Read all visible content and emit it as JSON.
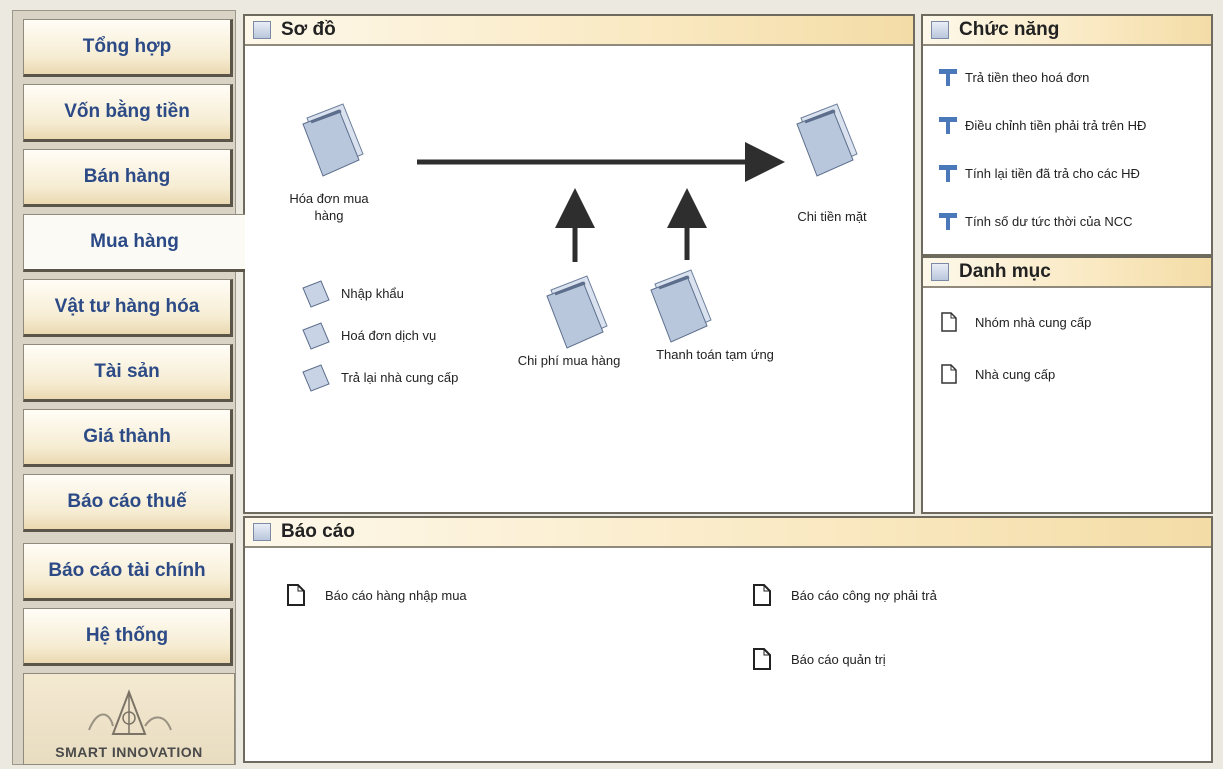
{
  "sidebar": {
    "items": [
      {
        "label": "Tổng hợp"
      },
      {
        "label": "Vốn bằng tiền"
      },
      {
        "label": "Bán hàng"
      },
      {
        "label": "Mua hàng"
      },
      {
        "label": "Vật tư hàng hóa"
      },
      {
        "label": "Tài sản"
      },
      {
        "label": "Giá thành"
      },
      {
        "label": "Báo cáo thuế"
      },
      {
        "label": "Báo cáo tài chính"
      },
      {
        "label": "Hệ thống"
      }
    ],
    "active": "Mua hàng",
    "logo_text": "SMART INNOVATION"
  },
  "diagram": {
    "title": "Sơ đồ",
    "nodes": {
      "invoice": "Hóa đơn mua hàng",
      "cash": "Chi tiền mặt",
      "purchase_cost": "Chi phí mua hàng",
      "advance": "Thanh toán tạm ứng"
    },
    "links": [
      "Nhập khẩu",
      "Hoá đơn dịch vụ",
      "Trả lại nhà cung cấp"
    ]
  },
  "functions": {
    "title": "Chức năng",
    "items": [
      "Trả tiền theo hoá đơn",
      "Điều chỉnh tiền phải trả trên HĐ",
      "Tính lại tiền đã trả cho các HĐ",
      "Tính số dư tức thời của NCC"
    ]
  },
  "catalog": {
    "title": "Danh mục",
    "items": [
      "Nhóm nhà cung cấp",
      "Nhà cung cấp"
    ]
  },
  "reports": {
    "title": "Báo cáo",
    "items": [
      "Báo cáo hàng nhập mua",
      "Báo cáo công nợ phải trả",
      "Báo cáo quản trị"
    ]
  },
  "colors": {
    "nav_text": "#2c4a86",
    "header_gradient_end": "#f3dca6",
    "panel_border": "#6e6a5e"
  },
  "icons": {
    "nav": "none",
    "diagram_node": "document-stack-icon",
    "function_item": "tool-icon",
    "catalog_item": "page-icon",
    "report_item": "report-icon"
  }
}
